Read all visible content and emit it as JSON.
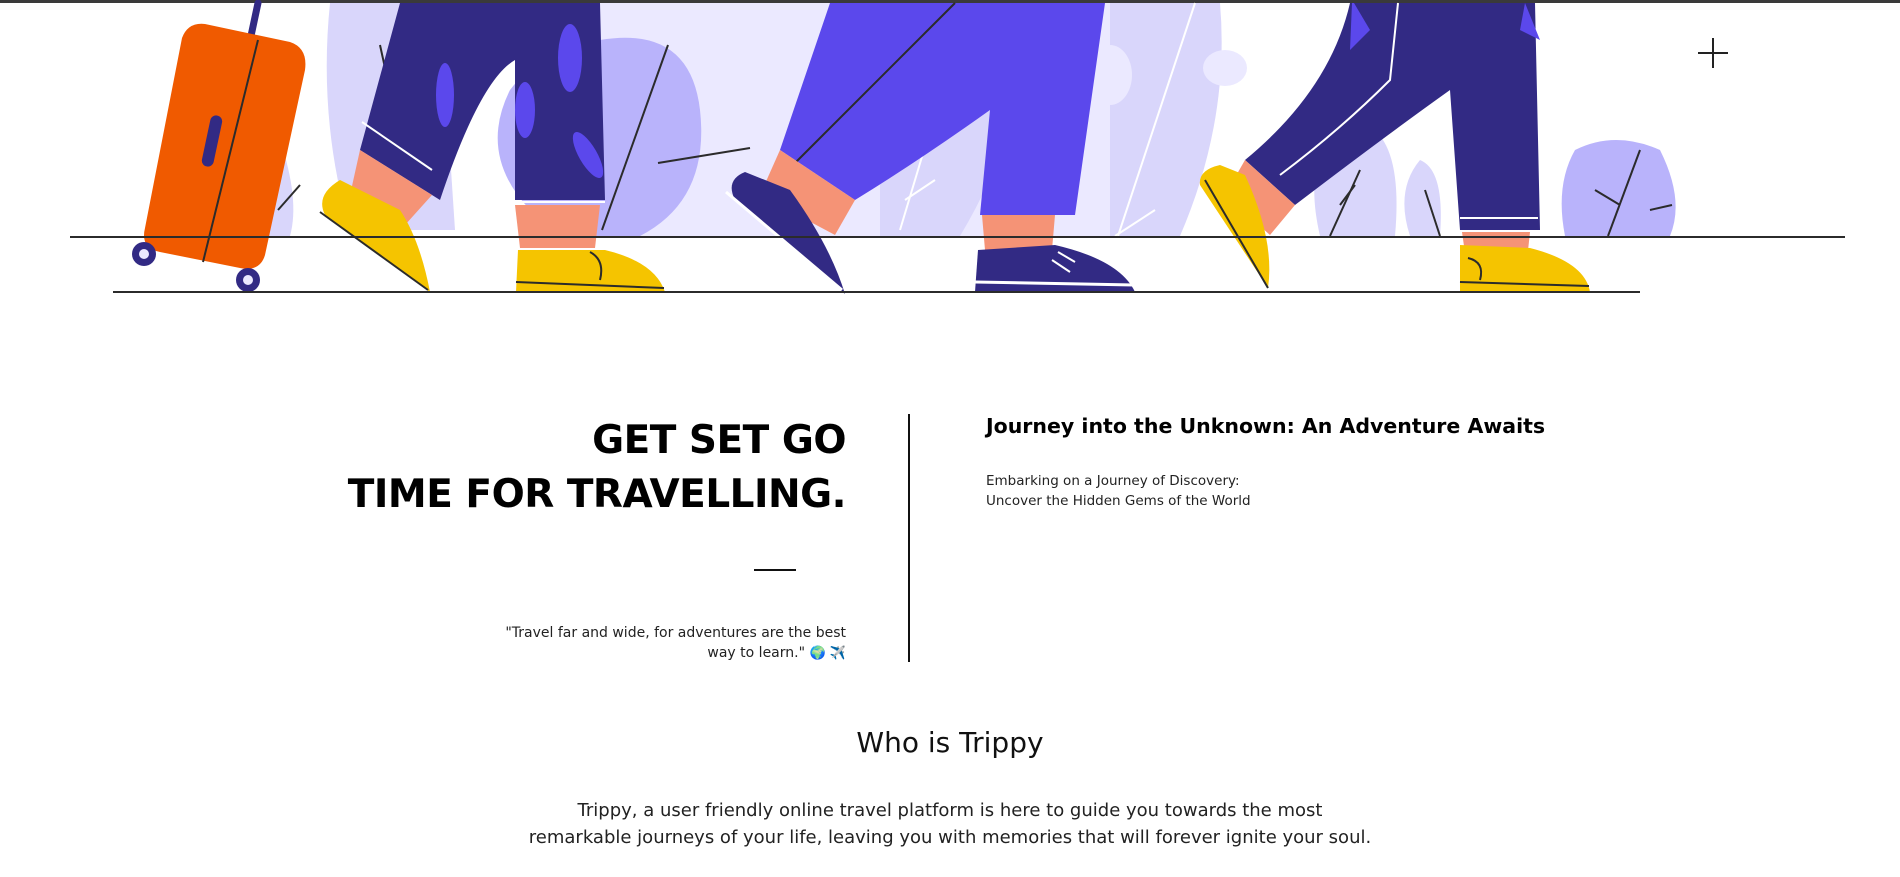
{
  "hero": {
    "illustration": "travellers-walking-with-suitcase",
    "colors": {
      "lavender_light": "#ebe9ff",
      "lavender": "#d9d6fb",
      "lavender_mid": "#b9b3fb",
      "purple": "#5b48ec",
      "navy": "#322a84",
      "skin": "#f59376",
      "yellow": "#f5c400",
      "orange": "#f05a00"
    }
  },
  "intro": {
    "headline_line1": "GET SET GO",
    "headline_line2": "TIME FOR TRAVELLING.",
    "quote": "\"Travel far and wide, for adventures are the best way to learn.\"",
    "quote_emoji": "🌍 ✈️"
  },
  "journey": {
    "title": "Journey into the Unknown: An Adventure Awaits",
    "line1": "Embarking on a Journey of Discovery:",
    "line2": "Uncover the Hidden Gems of the World"
  },
  "about": {
    "title": "Who is Trippy",
    "line1": "Trippy, a user friendly online travel platform is here to guide you towards the most",
    "line2": "remarkable journeys of your life, leaving you with memories that will forever ignite your soul."
  }
}
